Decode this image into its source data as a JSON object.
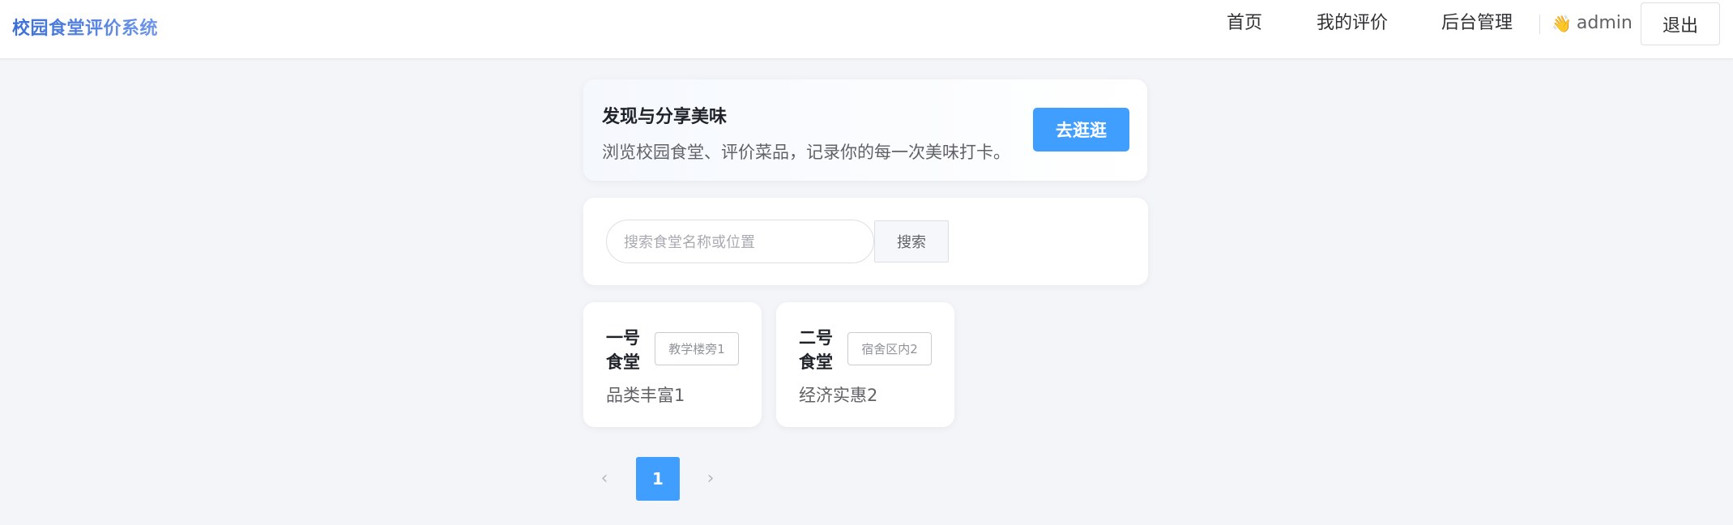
{
  "header": {
    "brand": "校园食堂评价系统",
    "nav": [
      {
        "label": "首页"
      },
      {
        "label": "我的评价"
      },
      {
        "label": "后台管理"
      }
    ],
    "user": {
      "icon": "waving-hand-icon",
      "glyph": "👋",
      "name": "admin"
    },
    "logout_label": "退出"
  },
  "hero": {
    "title": "发现与分享美味",
    "subtitle": "浏览校园食堂、评价菜品，记录你的每一次美味打卡。",
    "button_label": "去逛逛"
  },
  "search": {
    "placeholder": "搜索食堂名称或位置",
    "value": "",
    "button_label": "搜索"
  },
  "canteens": [
    {
      "name": "一号食堂",
      "location": "教学楼旁1",
      "description": "品类丰富1"
    },
    {
      "name": "二号食堂",
      "location": "宿舍区内2",
      "description": "经济实惠2"
    }
  ],
  "pagination": {
    "prev_icon": "chevron-left-icon",
    "next_icon": "chevron-right-icon",
    "current_page": "1"
  },
  "colors": {
    "accent": "#409eff",
    "brand_gradient_start": "#3a6fd8",
    "brand_gradient_end": "#6f96e8",
    "background": "#f3f5f9"
  }
}
